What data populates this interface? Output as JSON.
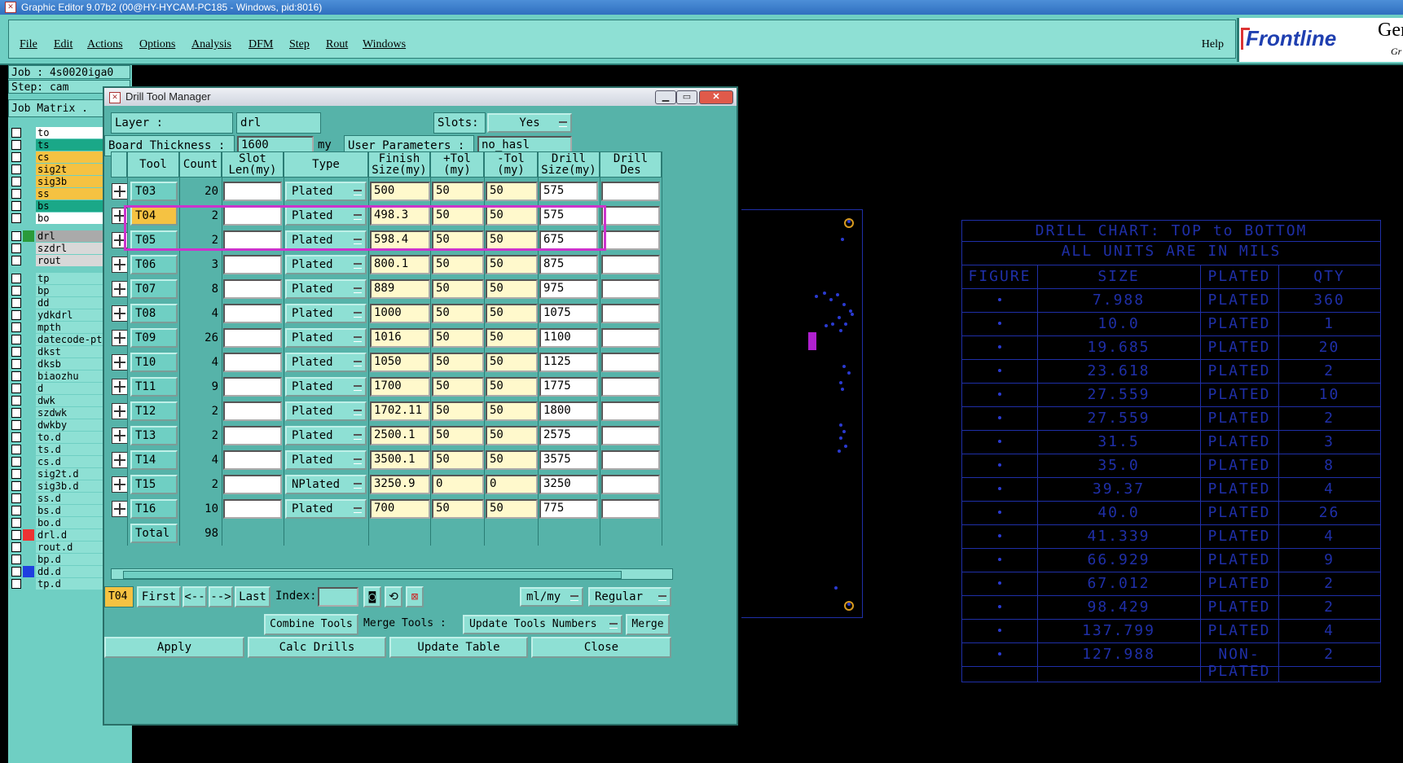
{
  "window": {
    "title": "Graphic Editor 9.07b2 (00@HY-HYCAM-PC185 - Windows, pid:8016)"
  },
  "menu": {
    "items": [
      "File",
      "Edit",
      "Actions",
      "Options",
      "Analysis",
      "DFM",
      "Step",
      "Rout",
      "Windows"
    ],
    "help": "Help"
  },
  "logo": {
    "brand": "Frontline",
    "suffix": "Ger",
    "sub": "Gr"
  },
  "left": {
    "job": "Job : 4s0020iga0",
    "step": "Step: cam",
    "matrix": "Job Matrix ."
  },
  "layers": [
    {
      "name": "to",
      "color": "#ffffff"
    },
    {
      "name": "ts",
      "color": "#1aa888"
    },
    {
      "name": "cs",
      "color": "#f5c242"
    },
    {
      "name": "sig2t",
      "color": "#f5c242"
    },
    {
      "name": "sig3b",
      "color": "#f5c242"
    },
    {
      "name": "ss",
      "color": "#f5c242"
    },
    {
      "name": "bs",
      "color": "#1aa888"
    },
    {
      "name": "bo",
      "color": "#ffffff"
    },
    {
      "name": "drl",
      "color": "#aaaaaa"
    },
    {
      "name": "szdrl",
      "color": "#d8d8d8"
    },
    {
      "name": "rout",
      "color": "#d8d8d8"
    },
    {
      "name": "tp",
      "color": "#8ee0d4"
    },
    {
      "name": "bp",
      "color": "#8ee0d4"
    },
    {
      "name": "dd",
      "color": "#8ee0d4"
    },
    {
      "name": "ydkdrl",
      "color": "#8ee0d4"
    },
    {
      "name": "mpth",
      "color": "#8ee0d4"
    },
    {
      "name": "datecode-pt",
      "color": "#8ee0d4"
    },
    {
      "name": "dkst",
      "color": "#8ee0d4"
    },
    {
      "name": "dksb",
      "color": "#8ee0d4"
    },
    {
      "name": "biaozhu",
      "color": "#8ee0d4"
    },
    {
      "name": "d",
      "color": "#8ee0d4"
    },
    {
      "name": "dwk",
      "color": "#8ee0d4"
    },
    {
      "name": "szdwk",
      "color": "#8ee0d4"
    },
    {
      "name": "dwkby",
      "color": "#8ee0d4"
    },
    {
      "name": "to.d",
      "color": "#8ee0d4"
    },
    {
      "name": "ts.d",
      "color": "#8ee0d4"
    },
    {
      "name": "cs.d",
      "color": "#8ee0d4"
    },
    {
      "name": "sig2t.d",
      "color": "#8ee0d4"
    },
    {
      "name": "sig3b.d",
      "color": "#8ee0d4"
    },
    {
      "name": "ss.d",
      "color": "#8ee0d4"
    },
    {
      "name": "bs.d",
      "color": "#8ee0d4"
    },
    {
      "name": "bo.d",
      "color": "#8ee0d4"
    },
    {
      "name": "drl.d",
      "color": "#8ee0d4"
    },
    {
      "name": "rout.d",
      "color": "#8ee0d4"
    },
    {
      "name": "bp.d",
      "color": "#8ee0d4"
    },
    {
      "name": "dd.d",
      "color": "#8ee0d4"
    },
    {
      "name": "tp.d",
      "color": "#8ee0d4"
    }
  ],
  "dialog": {
    "title": "Drill Tool Manager",
    "layer_label": "Layer           :",
    "layer_value": "drl",
    "slots_label": "Slots:",
    "slots_value": "Yes",
    "thickness_label": "Board Thickness :",
    "thickness_value": "1600",
    "thickness_unit": "my",
    "userparams_label": "User Parameters :",
    "userparams_value": "no_hasl",
    "headers": [
      "Tool",
      "Count",
      "Slot\nLen(my)",
      "Type",
      "Finish\nSize(my)",
      "+Tol\n(my)",
      "-Tol\n(my)",
      "Drill\nSize(my)",
      "Drill\nDes"
    ],
    "rows": [
      {
        "tool": "T03",
        "count": "20",
        "type": "Plated",
        "finish": "500",
        "ptol": "50",
        "mtol": "50",
        "drill": "575"
      },
      {
        "tool": "T04",
        "count": "2",
        "type": "Plated",
        "finish": "498.3",
        "ptol": "50",
        "mtol": "50",
        "drill": "575"
      },
      {
        "tool": "T05",
        "count": "2",
        "type": "Plated",
        "finish": "598.4",
        "ptol": "50",
        "mtol": "50",
        "drill": "675"
      },
      {
        "tool": "T06",
        "count": "3",
        "type": "Plated",
        "finish": "800.1",
        "ptol": "50",
        "mtol": "50",
        "drill": "875"
      },
      {
        "tool": "T07",
        "count": "8",
        "type": "Plated",
        "finish": "889",
        "ptol": "50",
        "mtol": "50",
        "drill": "975"
      },
      {
        "tool": "T08",
        "count": "4",
        "type": "Plated",
        "finish": "1000",
        "ptol": "50",
        "mtol": "50",
        "drill": "1075"
      },
      {
        "tool": "T09",
        "count": "26",
        "type": "Plated",
        "finish": "1016",
        "ptol": "50",
        "mtol": "50",
        "drill": "1100"
      },
      {
        "tool": "T10",
        "count": "4",
        "type": "Plated",
        "finish": "1050",
        "ptol": "50",
        "mtol": "50",
        "drill": "1125"
      },
      {
        "tool": "T11",
        "count": "9",
        "type": "Plated",
        "finish": "1700",
        "ptol": "50",
        "mtol": "50",
        "drill": "1775"
      },
      {
        "tool": "T12",
        "count": "2",
        "type": "Plated",
        "finish": "1702.11",
        "ptol": "50",
        "mtol": "50",
        "drill": "1800"
      },
      {
        "tool": "T13",
        "count": "2",
        "type": "Plated",
        "finish": "2500.1",
        "ptol": "50",
        "mtol": "50",
        "drill": "2575"
      },
      {
        "tool": "T14",
        "count": "4",
        "type": "Plated",
        "finish": "3500.1",
        "ptol": "50",
        "mtol": "50",
        "drill": "3575"
      },
      {
        "tool": "T15",
        "count": "2",
        "type": "NPlated",
        "finish": "3250.9",
        "ptol": "0",
        "mtol": "0",
        "drill": "3250"
      },
      {
        "tool": "T16",
        "count": "10",
        "type": "Plated",
        "finish": "700",
        "ptol": "50",
        "mtol": "50",
        "drill": "775"
      }
    ],
    "total_label": "Total",
    "total_value": "98",
    "selected_tool": "T04",
    "nav": {
      "first": "First",
      "prev": "<--",
      "next": "-->",
      "last": "Last",
      "index_label": "Index:"
    },
    "units_value": "ml/my",
    "mode_value": "Regular",
    "combine": "Combine Tools",
    "merge_label": "Merge Tools  :",
    "merge_value": "Update Tools Numbers",
    "merge_btn": "Merge",
    "apply": "Apply",
    "calc": "Calc Drills",
    "update": "Update Table",
    "close": "Close"
  },
  "chart": {
    "title1": "DRILL CHART: TOP to BOTTOM",
    "title2": "ALL UNITS ARE IN MILS",
    "headers": [
      "FIGURE",
      "SIZE",
      "PLATED",
      "QTY"
    ],
    "rows": [
      {
        "size": "7.988",
        "plated": "PLATED",
        "qty": "360"
      },
      {
        "size": "10.0",
        "plated": "PLATED",
        "qty": "1"
      },
      {
        "size": "19.685",
        "plated": "PLATED",
        "qty": "20"
      },
      {
        "size": "23.618",
        "plated": "PLATED",
        "qty": "2"
      },
      {
        "size": "27.559",
        "plated": "PLATED",
        "qty": "10"
      },
      {
        "size": "27.559",
        "plated": "PLATED",
        "qty": "2"
      },
      {
        "size": "31.5",
        "plated": "PLATED",
        "qty": "3"
      },
      {
        "size": "35.0",
        "plated": "PLATED",
        "qty": "8"
      },
      {
        "size": "39.37",
        "plated": "PLATED",
        "qty": "4"
      },
      {
        "size": "40.0",
        "plated": "PLATED",
        "qty": "26"
      },
      {
        "size": "41.339",
        "plated": "PLATED",
        "qty": "4"
      },
      {
        "size": "66.929",
        "plated": "PLATED",
        "qty": "9"
      },
      {
        "size": "67.012",
        "plated": "PLATED",
        "qty": "2"
      },
      {
        "size": "98.429",
        "plated": "PLATED",
        "qty": "2"
      },
      {
        "size": "137.799",
        "plated": "PLATED",
        "qty": "4"
      },
      {
        "size": "127.988",
        "plated": "NON-PLATED",
        "qty": "2"
      }
    ]
  },
  "colors": {
    "panel": "#6fcfc3",
    "field": "#fff9cc",
    "selected": "#f5c242",
    "highlight": "#cc33cc",
    "chart": "#1f2fa8"
  }
}
